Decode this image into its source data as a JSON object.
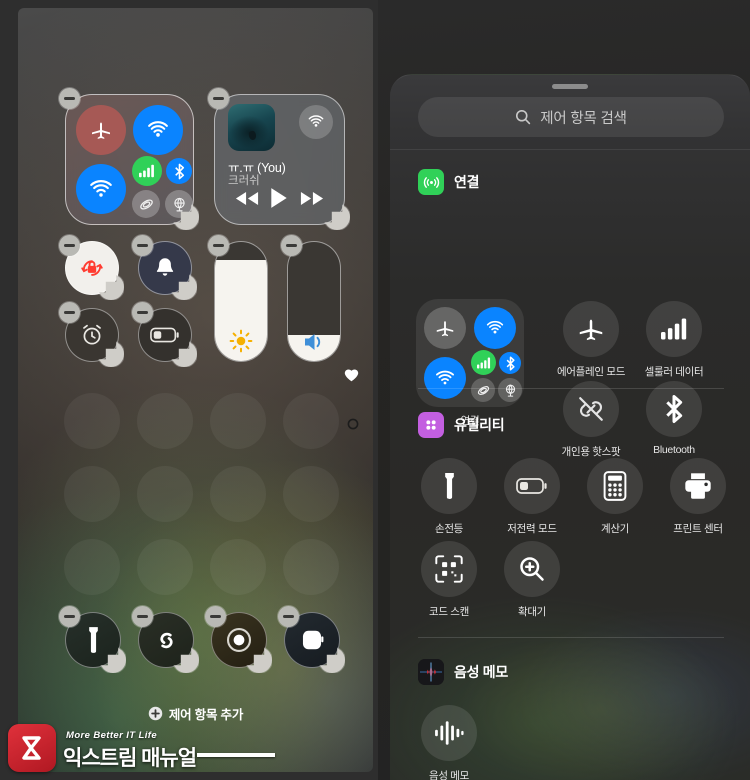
{
  "left_panel": {
    "name": "control-center-edit-mode",
    "connectivity_module": {
      "buttons": [
        {
          "name": "airplane-mode",
          "state": "on"
        },
        {
          "name": "airdrop",
          "state": "on"
        },
        {
          "name": "wifi",
          "state": "on"
        },
        {
          "name": "cellular-data",
          "state": "on"
        },
        {
          "name": "bluetooth",
          "state": "on"
        },
        {
          "name": "satellite",
          "state": "off"
        },
        {
          "name": "vpn",
          "state": "off"
        }
      ]
    },
    "media_widget": {
      "track_title": "ㅠ.ㅠ (You)",
      "artist": "크러쉬",
      "controls": [
        "rewind",
        "play",
        "fast-forward"
      ],
      "airplay": "airplay-icon"
    },
    "toggles": [
      {
        "name": "rotation-lock",
        "state": "on"
      },
      {
        "name": "silent-mode",
        "state": "on"
      },
      {
        "name": "alarm",
        "state": "off"
      },
      {
        "name": "low-power-mode",
        "state": "off"
      }
    ],
    "sliders": [
      {
        "name": "brightness",
        "value": 85,
        "icon": "sun-icon"
      },
      {
        "name": "volume",
        "value": 22,
        "icon": "speaker-icon"
      }
    ],
    "page_indicators": [
      {
        "name": "favorites-page",
        "icon": "heart-filled",
        "active": true
      },
      {
        "name": "second-page",
        "icon": "circle-outline",
        "active": false
      }
    ],
    "bottom_apps": [
      {
        "name": "flashlight",
        "icon": "flashlight-icon"
      },
      {
        "name": "shazam",
        "icon": "shazam-icon"
      },
      {
        "name": "screen-record",
        "icon": "record-icon"
      },
      {
        "name": "apple-watch",
        "icon": "watch-icon"
      }
    ],
    "add_control": {
      "label": "제어 항목 추가",
      "icon": "plus-circle-icon"
    }
  },
  "right_panel": {
    "name": "control-gallery",
    "search": {
      "placeholder": "제어 항목 검색",
      "icon": "search-icon"
    },
    "sections": [
      {
        "title": "연결",
        "icon": "connectivity-icon",
        "icon_color": "#30d158",
        "group_label": "연결",
        "tiles": [
          {
            "label": "에어플레인 모드",
            "icon": "airplane-icon"
          },
          {
            "label": "셀룰러 데이터",
            "icon": "cellular-bars-icon"
          },
          {
            "label": "개인용 핫스팟",
            "icon": "hotspot-off-icon"
          },
          {
            "label": "Bluetooth",
            "icon": "bluetooth-icon"
          }
        ]
      },
      {
        "title": "유틸리티",
        "icon": "utilities-icon",
        "icon_color": "#c35fe0",
        "tiles": [
          {
            "label": "손전등",
            "icon": "flashlight-icon"
          },
          {
            "label": "저전력 모드",
            "icon": "battery-low-icon"
          },
          {
            "label": "계산기",
            "icon": "calculator-icon"
          },
          {
            "label": "프린트 센터",
            "icon": "printer-icon"
          },
          {
            "label": "코드 스캔",
            "icon": "qr-scan-icon"
          },
          {
            "label": "확대기",
            "icon": "magnifier-plus-icon"
          }
        ]
      },
      {
        "title": "음성 메모",
        "icon": "voice-memos-icon",
        "icon_color": "#1c1c1e",
        "tiles": [
          {
            "label": "음성 메모",
            "icon": "waveform-icon"
          }
        ]
      }
    ]
  },
  "watermark": {
    "tagline": "More Better IT Life",
    "brand": "익스트림 매뉴얼",
    "logo": "ex-logo"
  }
}
